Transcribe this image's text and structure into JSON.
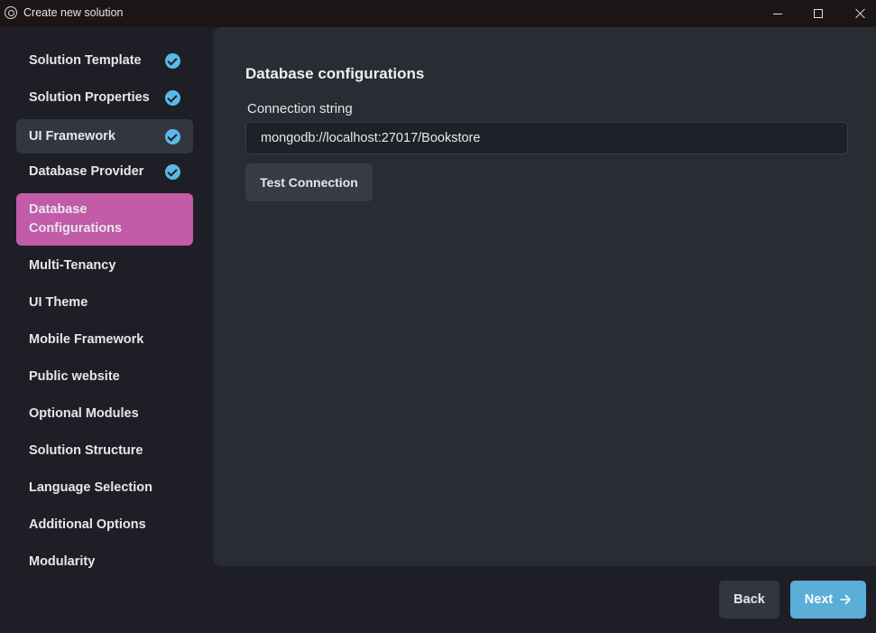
{
  "window": {
    "title": "Create new solution"
  },
  "sidebar": {
    "items": [
      {
        "label": "Solution Template",
        "completed": true
      },
      {
        "label": "Solution Properties",
        "completed": true
      },
      {
        "label": "UI Framework",
        "completed": true
      },
      {
        "label": "Database Provider",
        "completed": true
      },
      {
        "label": "Database Configurations",
        "completed": false,
        "active": true
      },
      {
        "label": "Multi-Tenancy",
        "completed": false
      },
      {
        "label": "UI Theme",
        "completed": false
      },
      {
        "label": "Mobile Framework",
        "completed": false
      },
      {
        "label": "Public website",
        "completed": false
      },
      {
        "label": "Optional Modules",
        "completed": false
      },
      {
        "label": "Solution Structure",
        "completed": false
      },
      {
        "label": "Language Selection",
        "completed": false
      },
      {
        "label": "Additional Options",
        "completed": false
      },
      {
        "label": "Modularity",
        "completed": false
      }
    ]
  },
  "main": {
    "title": "Database configurations",
    "connection_label": "Connection string",
    "connection_value": "mongodb://localhost:27017/Bookstore",
    "test_button": "Test Connection"
  },
  "footer": {
    "back_label": "Back",
    "next_label": "Next"
  },
  "colors": {
    "active_item": "#c25ba8",
    "check": "#5bb8e8",
    "next_button": "#5aaed8",
    "panel": "#2a2c34",
    "background": "#1e1f26"
  }
}
